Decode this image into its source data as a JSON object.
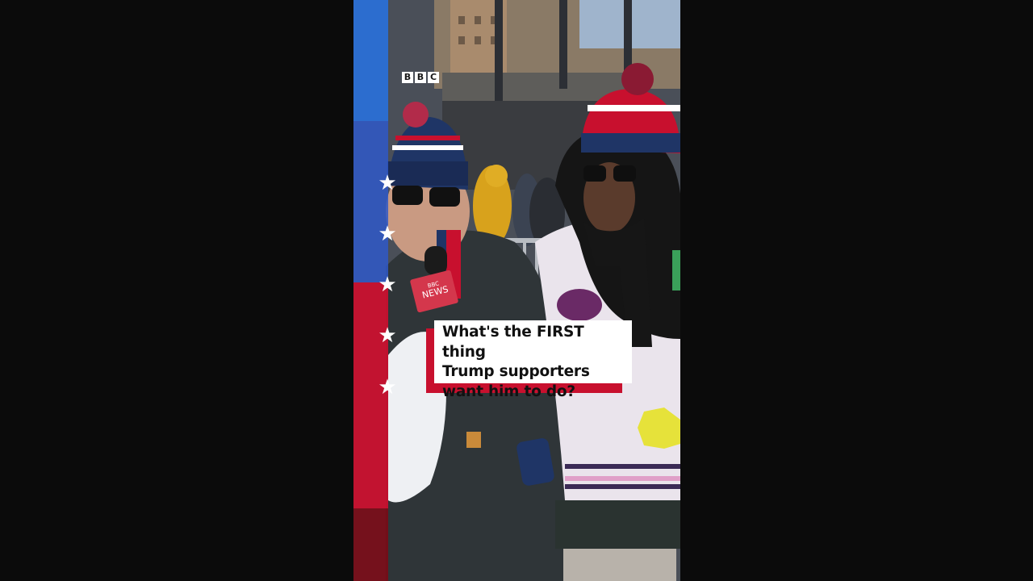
{
  "caption": {
    "line1": "What's the FIRST thing",
    "line2": "Trump supporters",
    "line3": "want him to do?"
  },
  "logo": {
    "letters": [
      "B",
      "B",
      "C"
    ]
  },
  "mic_flag": {
    "brand": "BBC",
    "label": "NEWS"
  },
  "colors": {
    "caption_accent": "#c8102e",
    "stripe_blue": "#2a6fd6",
    "stripe_red": "#c8102e",
    "letterbox": "#0b0b0b"
  }
}
